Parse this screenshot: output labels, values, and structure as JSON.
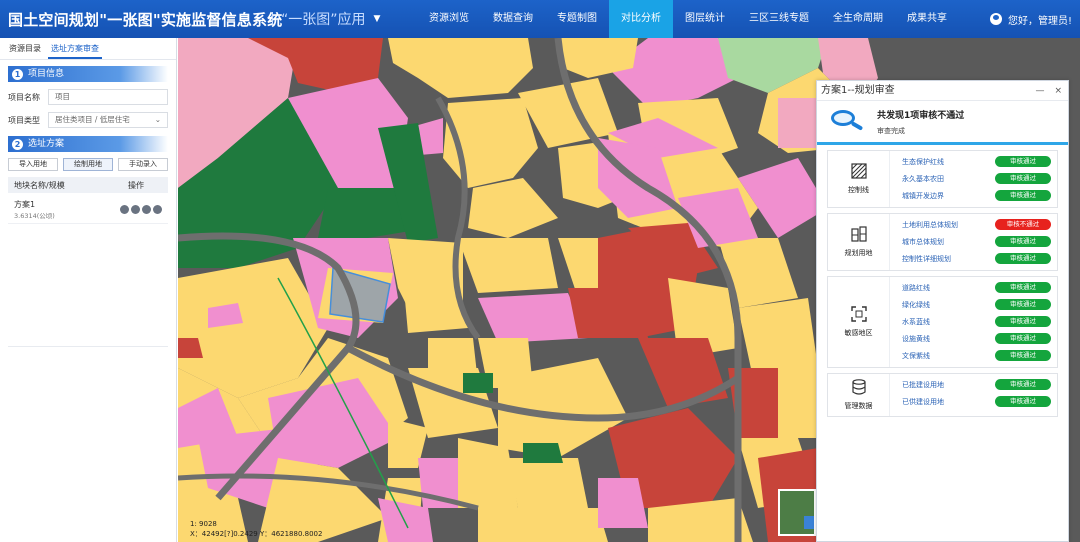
{
  "header": {
    "title": "国土空间规划\"一张图\"实施监督信息系统",
    "subtitle": "“一张图”应用",
    "nav": [
      "资源浏览",
      "数据查询",
      "专题制图",
      "对比分析",
      "图层统计",
      "三区三线专题",
      "全生命周期",
      "成果共享"
    ],
    "active_nav": "对比分析",
    "user_text": "您好，管理员!"
  },
  "left": {
    "tabs": [
      "资源目录",
      "选址方案审查"
    ],
    "active_tab": "选址方案审查",
    "section1": {
      "num": "1",
      "title": "项目信息"
    },
    "name_label": "项目名称",
    "name_value": "项目",
    "type_label": "项目类型",
    "type_value": "居住类项目 / 低层住宅",
    "section2": {
      "num": "2",
      "title": "选址方案"
    },
    "buttons": [
      "导入用地",
      "绘制用地",
      "手动录入"
    ],
    "list_headers": [
      "地块名称/规模",
      "操作"
    ],
    "list": [
      {
        "name": "方案1",
        "size": "3.6314(公顷)"
      }
    ]
  },
  "map": {
    "scale": "1: 9028",
    "coords": "X：42492[?]0.2429    Y：4621880.8002"
  },
  "panel": {
    "title": "方案1--规划审查",
    "summary_title": "共发现1项审核不通过",
    "summary_sub": "审查完成",
    "groups": [
      {
        "name": "控制线",
        "icon": "hatch-square-icon",
        "items": [
          {
            "label": "生态保护红线",
            "status": "审核通过",
            "pass": true
          },
          {
            "label": "永久基本农田",
            "status": "审核通过",
            "pass": true
          },
          {
            "label": "城镇开发边界",
            "status": "审核通过",
            "pass": true
          }
        ]
      },
      {
        "name": "规划用地",
        "icon": "buildings-icon",
        "items": [
          {
            "label": "土地利用总体规划",
            "status": "审核不通过",
            "pass": false
          },
          {
            "label": "城市总体规划",
            "status": "审核通过",
            "pass": true
          },
          {
            "label": "控制性详细规划",
            "status": "审核通过",
            "pass": true
          }
        ]
      },
      {
        "name": "敏感地区",
        "icon": "frame-icon",
        "items": [
          {
            "label": "道路红线",
            "status": "审核通过",
            "pass": true
          },
          {
            "label": "绿化绿线",
            "status": "审核通过",
            "pass": true
          },
          {
            "label": "水系蓝线",
            "status": "审核通过",
            "pass": true
          },
          {
            "label": "设施黄线",
            "status": "审核通过",
            "pass": true
          },
          {
            "label": "文保紫线",
            "status": "审核通过",
            "pass": true
          }
        ]
      },
      {
        "name": "管理数据",
        "icon": "database-icon",
        "items": [
          {
            "label": "已批建设用地",
            "status": "审核通过",
            "pass": true
          },
          {
            "label": "已供建设用地",
            "status": "审核通过",
            "pass": true
          }
        ]
      }
    ]
  },
  "colors": {
    "header": "#1d63c9",
    "active_nav": "#1aa3e6",
    "pass": "#14a53d",
    "fail": "#e7221e"
  }
}
